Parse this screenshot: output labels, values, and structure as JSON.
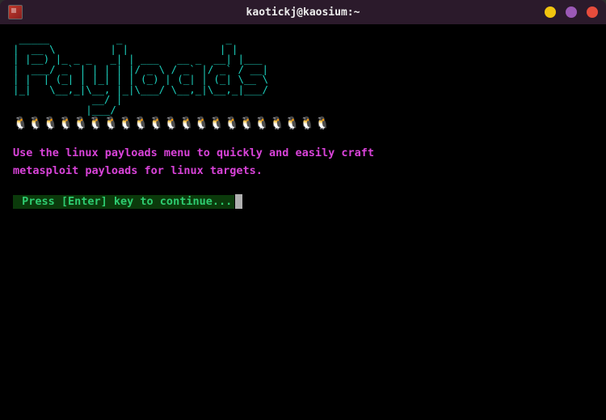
{
  "window": {
    "title": "kaotickj@kaosium:~"
  },
  "ascii_art": " _____           _                 _     \n|  __ \\         | |               | |    \n| |__) |_ _ _   _| | ___   __ _  __| |___ \n|  ___/ _` | | | | |/ _ \\ / _` |/ _` / __|\n| |  | (_| | |_| | | (_) | (_| | (_| \\__ \\\n|_|   \\__,_|\\__, |_|\\___/ \\__,_|\\__,_|___/\n             __/ |                        \n            |___/                         ",
  "penguins": "🐧🐧🐧🐧🐧🐧🐧🐧🐧🐧🐧🐧🐧🐧🐧🐧🐧🐧🐧🐧🐧",
  "description": "Use the linux payloads menu to quickly and easily craft\nmetasploit payloads for linux targets.",
  "prompt": " Press [Enter] key to continue..."
}
